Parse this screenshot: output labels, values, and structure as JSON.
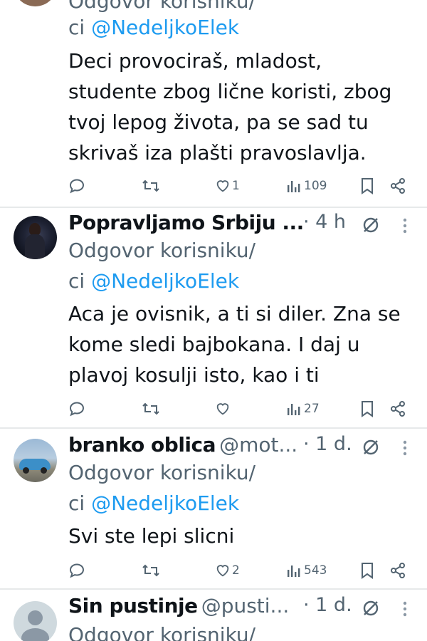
{
  "tweets": [
    {
      "reply_prefix": "Odgovor korisniku/",
      "reply_mid": "ci ",
      "reply_handle": "@NedeljkoElek",
      "text_lines": [
        "Deci provociraš, mladost,",
        "studente zbog lične koristi, zbog",
        "tvoj lepog života, pa se sad tu",
        "skrivaš iza plašti pravoslavlja."
      ],
      "likes": "1",
      "views": "109"
    },
    {
      "name": "Popravljamo Srbiju ...",
      "time": "· 4 h",
      "reply_prefix": "Odgovor korisniku/",
      "reply_mid": "ci ",
      "reply_handle": "@NedeljkoElek",
      "text_lines": [
        "Aca je ovisnik, a ti si diler. Zna se",
        "kome sledi bajbokana. I daj u",
        "plavoj kosulji isto, kao i ti"
      ],
      "likes": "",
      "views": "27"
    },
    {
      "name": "branko oblica",
      "handle": "@mot...",
      "time": "· 1 d.",
      "reply_prefix": "Odgovor korisniku/",
      "reply_mid": "ci ",
      "reply_handle": "@NedeljkoElek",
      "text_lines": [
        "Svi ste lepi slicni"
      ],
      "likes": "2",
      "views": "543"
    },
    {
      "name": "Sin pustinje",
      "handle": "@pusti...",
      "time": "· 1 d.",
      "reply_prefix": "Odgovor korisniku/"
    }
  ],
  "colors": {
    "link": "#1d9bf0",
    "muted": "#536471",
    "text": "#0f1419",
    "divider": "#e7e9ea"
  },
  "icons": [
    "reply-icon",
    "retweet-icon",
    "like-icon",
    "views-icon",
    "bookmark-icon",
    "share-icon",
    "mute-icon",
    "more-icon"
  ]
}
